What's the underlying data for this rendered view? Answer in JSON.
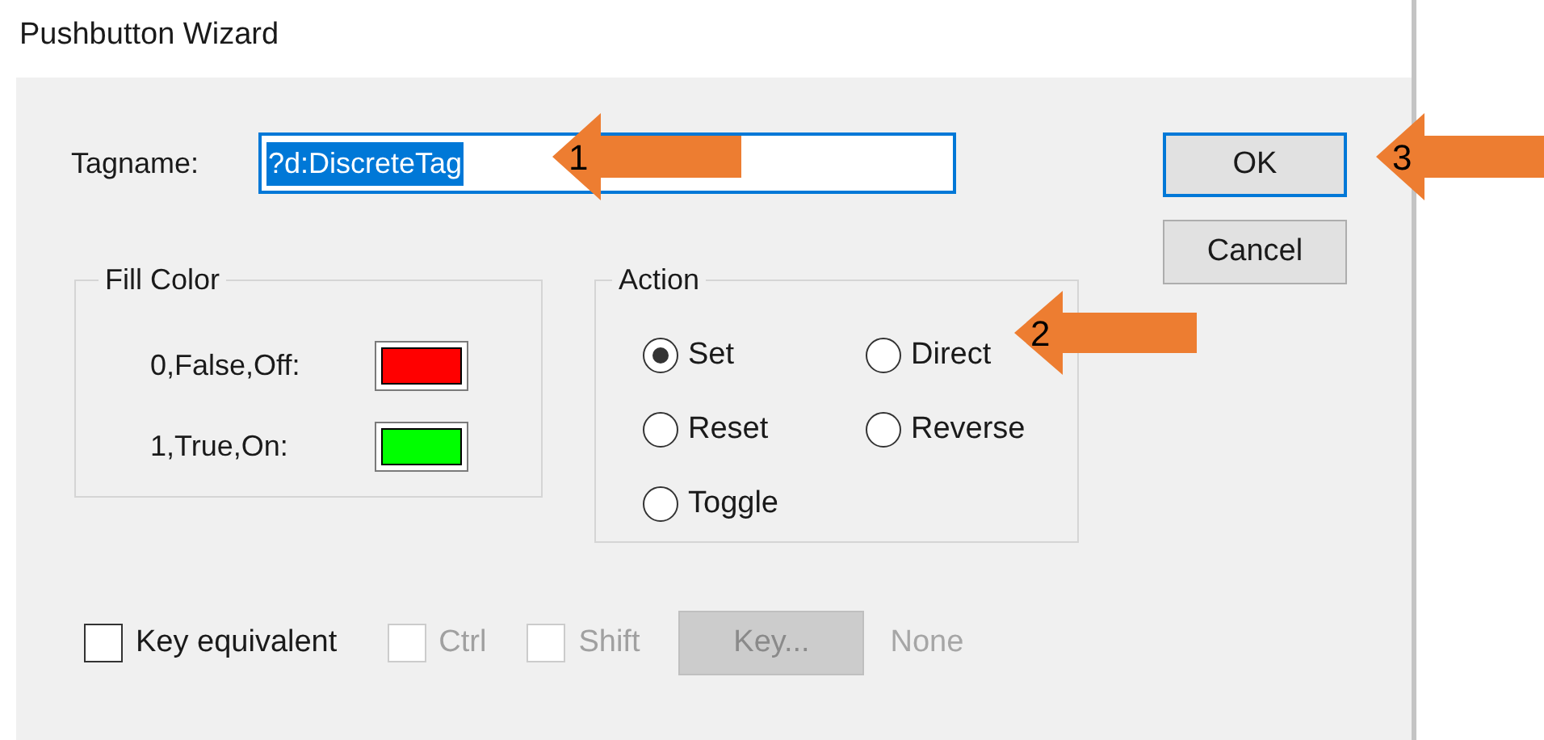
{
  "window": {
    "title": "Pushbutton Wizard"
  },
  "tagname": {
    "label": "Tagname:",
    "value": "?d:DiscreteTag",
    "text_selected": true
  },
  "buttons": [
    {
      "label": "OK",
      "default": true
    },
    {
      "label": "Cancel",
      "default": false
    }
  ],
  "fill_color": {
    "title": "Fill Color",
    "rows": [
      {
        "label": "0,False,Off:",
        "color": "#ff0000"
      },
      {
        "label": "1,True,On:",
        "color": "#00ff00"
      }
    ]
  },
  "action": {
    "title": "Action",
    "options": [
      {
        "label": "Set",
        "selected": true
      },
      {
        "label": "Direct",
        "selected": false
      },
      {
        "label": "Reset",
        "selected": false
      },
      {
        "label": "Reverse",
        "selected": false
      },
      {
        "label": "Toggle",
        "selected": false
      }
    ]
  },
  "key_options": [
    {
      "label": "Key equivalent",
      "checked": false,
      "disabled": false
    },
    {
      "label": "Ctrl",
      "checked": false,
      "disabled": true
    },
    {
      "label": "Shift",
      "checked": false,
      "disabled": true
    }
  ],
  "key_button": {
    "label": "Key...",
    "disabled": true
  },
  "key_value": {
    "text": "None",
    "disabled": true
  },
  "callouts": [
    {
      "label": "1"
    },
    {
      "label": "2"
    },
    {
      "label": "3"
    }
  ]
}
